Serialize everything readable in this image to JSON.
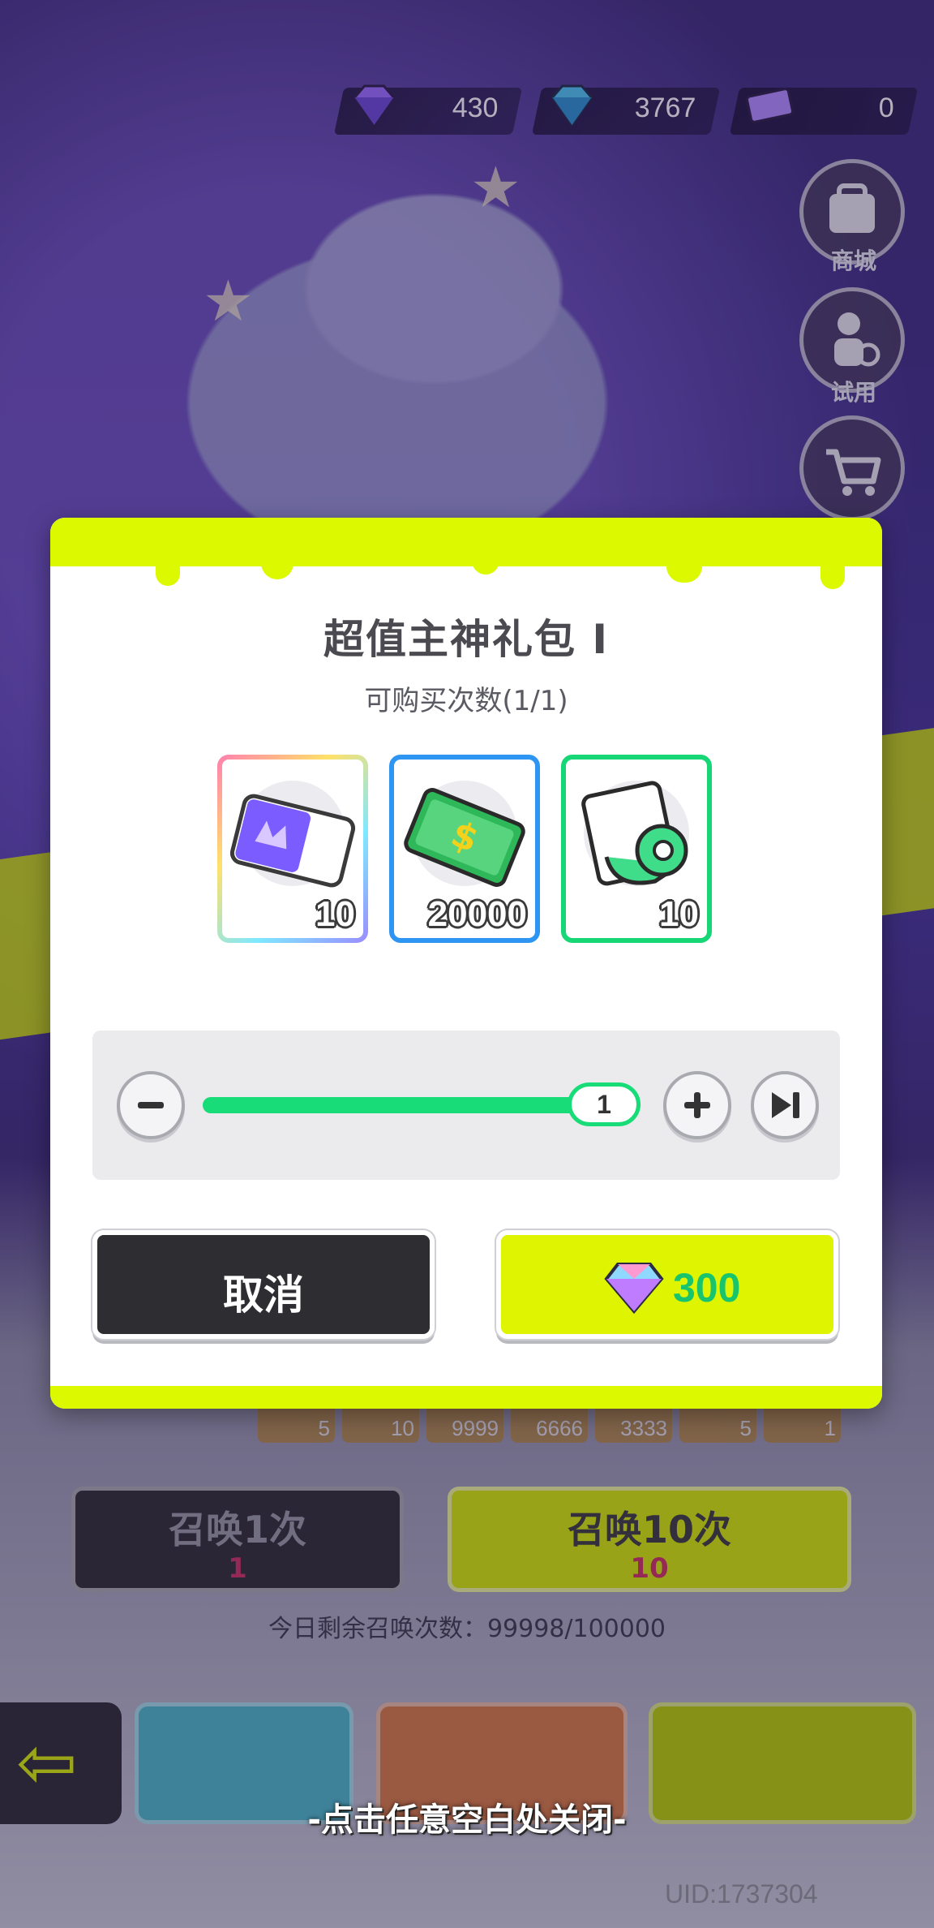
{
  "currencies": [
    {
      "icon": "purple-diamond-icon",
      "value": "430"
    },
    {
      "icon": "blue-diamond-icon",
      "value": "3767"
    },
    {
      "icon": "ticket-icon",
      "value": "0"
    }
  ],
  "side_menu": [
    {
      "icon": "shop-icon",
      "label": "商城"
    },
    {
      "icon": "trial-icon",
      "label": "试用"
    },
    {
      "icon": "cart-icon",
      "label": ""
    }
  ],
  "modal": {
    "title": "超值主神礼包 I",
    "subtitle": "可购买次数(1/1)",
    "items": [
      {
        "icon": "summon-ticket-icon",
        "count": "10"
      },
      {
        "icon": "cash-icon",
        "count": "20000"
      },
      {
        "icon": "green-scroll-icon",
        "count": "10"
      }
    ],
    "quantity": {
      "value": "1",
      "fill_percent": 100
    },
    "cancel_label": "取消",
    "buy_price": "300",
    "colors": {
      "accent": "#dcf900",
      "slider": "#18dc78"
    }
  },
  "background": {
    "reward_counts": [
      "5",
      "10",
      "9999",
      "6666",
      "3333",
      "5",
      "1"
    ],
    "summon_once": {
      "label": "召唤1次",
      "cost": "1"
    },
    "summon_ten": {
      "label": "召唤10次",
      "cost": "10"
    },
    "remaining_text": "今日剩余召唤次数：99998/100000"
  },
  "close_hint": "-点击任意空白处关闭-",
  "uid": "UID:1737304"
}
